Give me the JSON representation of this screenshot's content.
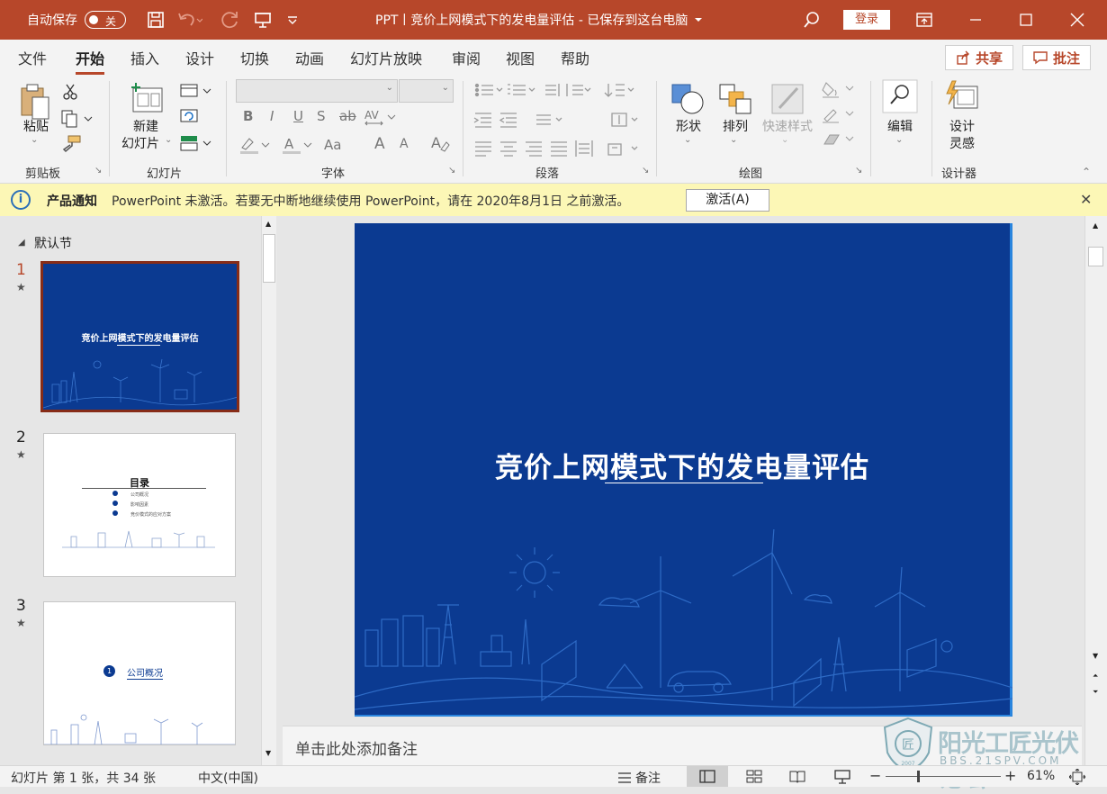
{
  "titlebar": {
    "autosave_label": "自动保存",
    "autosave_state": "关",
    "doc_title": "PPT丨竞价上网模式下的发电量评估 - 已保存到这台电脑",
    "login_label": "登录"
  },
  "tabs": [
    "文件",
    "开始",
    "插入",
    "设计",
    "切换",
    "动画",
    "幻灯片放映",
    "审阅",
    "视图",
    "帮助"
  ],
  "active_tab": "开始",
  "share_label": "共享",
  "comment_label": "批注",
  "ribbon": {
    "clipboard": {
      "group": "剪贴板",
      "paste": "粘贴"
    },
    "slides": {
      "group": "幻灯片",
      "new_slide_line1": "新建",
      "new_slide_line2": "幻灯片"
    },
    "font": {
      "group": "字体",
      "bold": "B",
      "italic": "I",
      "underline": "U",
      "shadow": "S",
      "strike": "ab",
      "grow": "A",
      "shrink": "A",
      "aa": "Aa"
    },
    "paragraph": {
      "group": "段落"
    },
    "drawing": {
      "group": "绘图",
      "shapes": "形状",
      "arrange": "排列",
      "quick_styles": "快速样式"
    },
    "editing": {
      "label": "编辑"
    },
    "designer": {
      "group": "设计器",
      "label_line1": "设计",
      "label_line2": "灵感"
    }
  },
  "notice": {
    "title": "产品通知",
    "message": "PowerPoint 未激活。若要无中断地继续使用 PowerPoint，请在 2020年8月1日 之前激活。",
    "button": "激活(A)"
  },
  "sidebar": {
    "section": "默认节",
    "slides": [
      {
        "num": "1",
        "title": "竞价上网模式下的发电量评估"
      },
      {
        "num": "2",
        "title": "目录",
        "items": [
          "公司概况",
          "影响因素",
          "竞价模式的应对方案"
        ]
      },
      {
        "num": "3",
        "number": "1",
        "title": "公司概况"
      }
    ]
  },
  "slide": {
    "title": "竞价上网模式下的发电量评估"
  },
  "notes_placeholder": "单击此处添加备注",
  "status": {
    "slide_info": "幻灯片 第 1 张，共 34 张",
    "language": "中文(中国)",
    "notes": "备注",
    "zoom": "61%",
    "zoom_minus": "−",
    "zoom_plus": "+"
  },
  "watermark": {
    "text": "阳光工匠光伏论坛",
    "url": "BBS.21SPV.COM",
    "year": "2007"
  },
  "colors": {
    "accent": "#b7472a",
    "slide_bg": "#0b3a91",
    "notice_bg": "#fcf7b6"
  }
}
